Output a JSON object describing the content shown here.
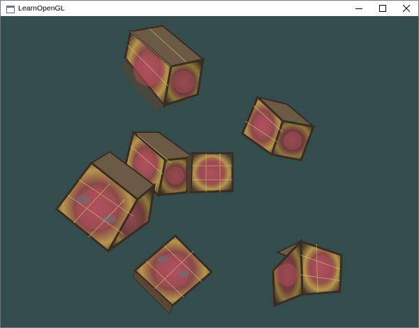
{
  "window": {
    "title": "LearnOpenGL",
    "controls": {
      "minimize_icon": "minimize-icon",
      "maximize_icon": "maximize-icon",
      "close_icon": "close-icon"
    }
  },
  "scene": {
    "clear_color": "#334d4d",
    "object": "textured-cube",
    "cube_count": 8
  }
}
